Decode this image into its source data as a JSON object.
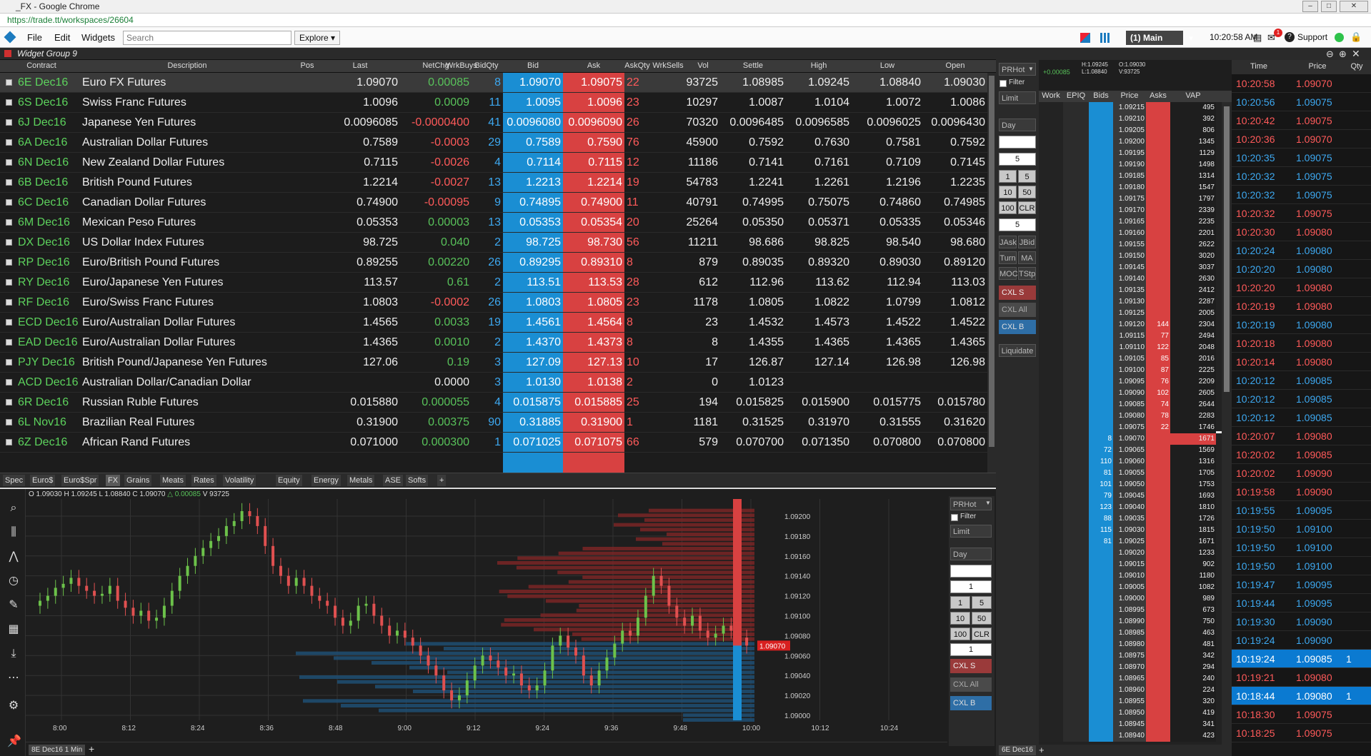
{
  "window": {
    "title": "_FX - Google Chrome",
    "url": "https://trade.tt/workspaces/26604"
  },
  "menu": {
    "file": "File",
    "edit": "Edit",
    "widgets": "Widgets",
    "search_placeholder": "Search",
    "explore": "Explore ▾",
    "workspace": "(1) Main",
    "time": "10:20:58 AM",
    "support": "Support",
    "alert_count": "1"
  },
  "widget_group": "Widget Group 9",
  "columns": [
    "Contract",
    "Description",
    "Pos",
    "Last",
    "NetChg",
    "WrkBuys",
    "BidQty",
    "Bid",
    "Ask",
    "AskQty",
    "WrkSells",
    "Vol",
    "Settle",
    "High",
    "Low",
    "Open"
  ],
  "rows": [
    {
      "contract": "6E Dec16",
      "desc": "Euro FX Futures",
      "last": "1.09070",
      "chg": "0.00085",
      "bidqty": "8",
      "bid": "1.09070",
      "ask": "1.09075",
      "askqty": "22",
      "vol": "93725",
      "settle": "1.08985",
      "high": "1.09245",
      "low": "1.08840",
      "open": "1.09030",
      "dir": "pos"
    },
    {
      "contract": "6S Dec16",
      "desc": "Swiss Franc Futures",
      "last": "1.0096",
      "chg": "0.0009",
      "bidqty": "11",
      "bid": "1.0095",
      "ask": "1.0096",
      "askqty": "23",
      "vol": "10297",
      "settle": "1.0087",
      "high": "1.0104",
      "low": "1.0072",
      "open": "1.0086",
      "dir": "pos"
    },
    {
      "contract": "6J Dec16",
      "desc": "Japanese Yen Futures",
      "last": "0.0096085",
      "chg": "-0.0000400",
      "bidqty": "41",
      "bid": "0.0096080",
      "ask": "0.0096090",
      "askqty": "26",
      "vol": "70320",
      "settle": "0.0096485",
      "high": "0.0096585",
      "low": "0.0096025",
      "open": "0.0096430",
      "dir": "neg"
    },
    {
      "contract": "6A Dec16",
      "desc": "Australian Dollar Futures",
      "last": "0.7589",
      "chg": "-0.0003",
      "bidqty": "29",
      "bid": "0.7589",
      "ask": "0.7590",
      "askqty": "76",
      "vol": "45900",
      "settle": "0.7592",
      "high": "0.7630",
      "low": "0.7581",
      "open": "0.7592",
      "dir": "neg"
    },
    {
      "contract": "6N Dec16",
      "desc": "New Zealand Dollar Futures",
      "last": "0.7115",
      "chg": "-0.0026",
      "bidqty": "4",
      "bid": "0.7114",
      "ask": "0.7115",
      "askqty": "12",
      "vol": "11186",
      "settle": "0.7141",
      "high": "0.7161",
      "low": "0.7109",
      "open": "0.7145",
      "dir": "neg"
    },
    {
      "contract": "6B Dec16",
      "desc": "British Pound Futures",
      "last": "1.2214",
      "chg": "-0.0027",
      "bidqty": "13",
      "bid": "1.2213",
      "ask": "1.2214",
      "askqty": "19",
      "vol": "54783",
      "settle": "1.2241",
      "high": "1.2261",
      "low": "1.2196",
      "open": "1.2235",
      "dir": "neg"
    },
    {
      "contract": "6C Dec16",
      "desc": "Canadian Dollar Futures",
      "last": "0.74900",
      "chg": "-0.00095",
      "bidqty": "9",
      "bid": "0.74895",
      "ask": "0.74900",
      "askqty": "11",
      "vol": "40791",
      "settle": "0.74995",
      "high": "0.75075",
      "low": "0.74860",
      "open": "0.74985",
      "dir": "neg"
    },
    {
      "contract": "6M Dec16",
      "desc": "Mexican Peso Futures",
      "last": "0.05353",
      "chg": "0.00003",
      "bidqty": "13",
      "bid": "0.05353",
      "ask": "0.05354",
      "askqty": "20",
      "vol": "25264",
      "settle": "0.05350",
      "high": "0.05371",
      "low": "0.05335",
      "open": "0.05346",
      "dir": "pos"
    },
    {
      "contract": "DX Dec16",
      "desc": "US Dollar Index Futures",
      "last": "98.725",
      "chg": "0.040",
      "bidqty": "2",
      "bid": "98.725",
      "ask": "98.730",
      "askqty": "56",
      "vol": "11211",
      "settle": "98.686",
      "high": "98.825",
      "low": "98.540",
      "open": "98.680",
      "dir": "pos"
    },
    {
      "contract": "RP Dec16",
      "desc": "Euro/British Pound Futures",
      "last": "0.89255",
      "chg": "0.00220",
      "bidqty": "26",
      "bid": "0.89295",
      "ask": "0.89310",
      "askqty": "8",
      "vol": "879",
      "settle": "0.89035",
      "high": "0.89320",
      "low": "0.89030",
      "open": "0.89120",
      "dir": "pos"
    },
    {
      "contract": "RY Dec16",
      "desc": "Euro/Japanese Yen Futures",
      "last": "113.57",
      "chg": "0.61",
      "bidqty": "2",
      "bid": "113.51",
      "ask": "113.53",
      "askqty": "28",
      "vol": "612",
      "settle": "112.96",
      "high": "113.62",
      "low": "112.94",
      "open": "113.03",
      "dir": "pos"
    },
    {
      "contract": "RF Dec16",
      "desc": "Euro/Swiss Franc Futures",
      "last": "1.0803",
      "chg": "-0.0002",
      "bidqty": "26",
      "bid": "1.0803",
      "ask": "1.0805",
      "askqty": "23",
      "vol": "1178",
      "settle": "1.0805",
      "high": "1.0822",
      "low": "1.0799",
      "open": "1.0812",
      "dir": "neg"
    },
    {
      "contract": "ECD Dec16",
      "desc": "Euro/Australian Dollar Futures",
      "last": "1.4565",
      "chg": "0.0033",
      "bidqty": "19",
      "bid": "1.4561",
      "ask": "1.4564",
      "askqty": "8",
      "vol": "23",
      "settle": "1.4532",
      "high": "1.4573",
      "low": "1.4522",
      "open": "1.4522",
      "dir": "pos"
    },
    {
      "contract": "EAD Dec16",
      "desc": "Euro/Australian Dollar Futures",
      "last": "1.4365",
      "chg": "0.0010",
      "bidqty": "2",
      "bid": "1.4370",
      "ask": "1.4373",
      "askqty": "8",
      "vol": "8",
      "settle": "1.4355",
      "high": "1.4365",
      "low": "1.4365",
      "open": "1.4365",
      "dir": "pos"
    },
    {
      "contract": "PJY Dec16",
      "desc": "British Pound/Japanese Yen Futures",
      "last": "127.06",
      "chg": "0.19",
      "bidqty": "3",
      "bid": "127.09",
      "ask": "127.13",
      "askqty": "10",
      "vol": "17",
      "settle": "126.87",
      "high": "127.14",
      "low": "126.98",
      "open": "126.98",
      "dir": "pos"
    },
    {
      "contract": "ACD Dec16",
      "desc": "Australian Dollar/Canadian Dollar",
      "last": "",
      "chg": "0.0000",
      "bidqty": "3",
      "bid": "1.0130",
      "ask": "1.0138",
      "askqty": "2",
      "vol": "0",
      "settle": "1.0123",
      "high": "",
      "low": "",
      "open": "",
      "dir": "zero"
    },
    {
      "contract": "6R Dec16",
      "desc": "Russian Ruble Futures",
      "last": "0.015880",
      "chg": "0.000055",
      "bidqty": "4",
      "bid": "0.015875",
      "ask": "0.015885",
      "askqty": "25",
      "vol": "194",
      "settle": "0.015825",
      "high": "0.015900",
      "low": "0.015775",
      "open": "0.015780",
      "dir": "pos"
    },
    {
      "contract": "6L Nov16",
      "desc": "Brazilian Real Futures",
      "last": "0.31900",
      "chg": "0.00375",
      "bidqty": "90",
      "bid": "0.31885",
      "ask": "0.31900",
      "askqty": "1",
      "vol": "1181",
      "settle": "0.31525",
      "high": "0.31970",
      "low": "0.31555",
      "open": "0.31620",
      "dir": "pos"
    },
    {
      "contract": "6Z Dec16",
      "desc": "African Rand Futures",
      "last": "0.071000",
      "chg": "0.000300",
      "bidqty": "1",
      "bid": "0.071025",
      "ask": "0.071075",
      "askqty": "66",
      "vol": "579",
      "settle": "0.070700",
      "high": "0.071350",
      "low": "0.070800",
      "open": "0.070800",
      "dir": "pos"
    }
  ],
  "tabs": [
    "Spec",
    "Euro$",
    "Euro$Spr",
    "FX",
    "Grains",
    "Meats",
    "Rates",
    "Volatility",
    "Equity",
    "Energy",
    "Metals",
    "ASE",
    "Softs",
    "+"
  ],
  "active_tab": "FX",
  "chart": {
    "ohlc": {
      "o": "O 1.09030",
      "h": "H 1.09245",
      "l": "L 1.08840",
      "c": "C 1.09070",
      "chg": "△ 0.00085",
      "v": "V 93725"
    },
    "contract_tab": "8E Dec16 1 Min",
    "price_marker": "1.09070"
  },
  "chart_data": {
    "type": "candlestick",
    "x_ticks": [
      "8:00",
      "8:12",
      "8:24",
      "8:36",
      "8:48",
      "9:00",
      "9:12",
      "9:24",
      "9:36",
      "9:48",
      "10:00",
      "10:12",
      "10:24"
    ],
    "y_ticks": [
      "1.09200",
      "1.09180",
      "1.09160",
      "1.09140",
      "1.09120",
      "1.09100",
      "1.09080",
      "1.09060",
      "1.09040",
      "1.09020",
      "1.09000"
    ],
    "ylim": [
      1.08995,
      1.0921
    ],
    "closes": [
      1.09115,
      1.0912,
      1.09128,
      1.09132,
      1.09138,
      1.0913,
      1.09125,
      1.0912,
      1.09122,
      1.0913,
      1.09115,
      1.09108,
      1.091,
      1.09105,
      1.09095,
      1.09098,
      1.0911,
      1.09125,
      1.0914,
      1.0915,
      1.0916,
      1.09168,
      1.09175,
      1.0918,
      1.0919,
      1.09195,
      1.09205,
      1.092,
      1.0919,
      1.0917,
      1.0915,
      1.0914,
      1.0913,
      1.09138,
      1.0913,
      1.0912,
      1.09115,
      1.0911,
      1.09098,
      1.0909,
      1.09095,
      1.0911,
      1.09112,
      1.091,
      1.0909,
      1.0908,
      1.09085,
      1.09078,
      1.0907,
      1.0906,
      1.0905,
      1.0904,
      1.09025,
      1.09015,
      1.0902,
      1.09035,
      1.0905,
      1.0906,
      1.09055,
      1.09048,
      1.0904,
      1.09042,
      1.0903,
      1.09025,
      1.0903,
      1.09045,
      1.0907,
      1.0908,
      1.09068,
      1.0906,
      1.0904,
      1.0903,
      1.09045,
      1.09058,
      1.09072,
      1.09085,
      1.0908,
      1.09098,
      1.0912,
      1.0914,
      1.0913,
      1.0911,
      1.09098,
      1.0909,
      1.091,
      1.09085,
      1.09078,
      1.09082,
      1.0909,
      1.09085,
      1.09078,
      1.0907
    ]
  },
  "order_panel": {
    "account": "PRHot",
    "filter": "Filter",
    "type": "Limit",
    "tif": "Day",
    "qty_top": "5",
    "qty": "5",
    "q1": "1",
    "q5": "5",
    "q10": "10",
    "q50": "50",
    "q100": "100",
    "clr": "CLR",
    "jask": "JAsk",
    "jbid": "JBid",
    "turn": "Turn",
    "ma": "MA",
    "moc": "MOC",
    "tstp": "TStp",
    "cxls": "CXL S",
    "cxla": "CXL All",
    "cxlb": "CXL B",
    "liquidate": "Liquidate",
    "chart_qty_top": "1",
    "chart_qty": "1"
  },
  "md_header": {
    "chg": "+0.00085",
    "hl": "H:1.09245\nL:1.08840",
    "ov": "O:1.09030\nV:93725",
    "cols": [
      "Work",
      "EPIQ",
      "Bids",
      "Price",
      "Asks",
      "VAP"
    ],
    "contract": "6E Dec16"
  },
  "ladder": [
    [
      "",
      "",
      "1.09215",
      "",
      "495"
    ],
    [
      "",
      "",
      "1.09210",
      "",
      "392"
    ],
    [
      "",
      "",
      "1.09205",
      "",
      "806"
    ],
    [
      "",
      "",
      "1.09200",
      "",
      "1345"
    ],
    [
      "",
      "",
      "1.09195",
      "",
      "1129"
    ],
    [
      "",
      "",
      "1.09190",
      "",
      "1498"
    ],
    [
      "",
      "",
      "1.09185",
      "",
      "1314"
    ],
    [
      "",
      "",
      "1.09180",
      "",
      "1547"
    ],
    [
      "",
      "",
      "1.09175",
      "",
      "1797"
    ],
    [
      "",
      "",
      "1.09170",
      "",
      "2339"
    ],
    [
      "",
      "",
      "1.09165",
      "",
      "2235"
    ],
    [
      "",
      "",
      "1.09160",
      "",
      "2201"
    ],
    [
      "",
      "",
      "1.09155",
      "",
      "2622"
    ],
    [
      "",
      "",
      "1.09150",
      "",
      "3020"
    ],
    [
      "",
      "",
      "1.09145",
      "",
      "3037"
    ],
    [
      "",
      "",
      "1.09140",
      "",
      "2630"
    ],
    [
      "",
      "",
      "1.09135",
      "",
      "2412"
    ],
    [
      "",
      "",
      "1.09130",
      "",
      "2287"
    ],
    [
      "",
      "",
      "1.09125",
      "",
      "2005"
    ],
    [
      "",
      "",
      "1.09120",
      "144",
      "2304"
    ],
    [
      "",
      "",
      "1.09115",
      "77",
      "2494"
    ],
    [
      "",
      "",
      "1.09110",
      "122",
      "2048"
    ],
    [
      "",
      "",
      "1.09105",
      "85",
      "2016"
    ],
    [
      "",
      "",
      "1.09100",
      "87",
      "2225"
    ],
    [
      "",
      "",
      "1.09095",
      "76",
      "2209"
    ],
    [
      "",
      "",
      "1.09090",
      "102",
      "2605"
    ],
    [
      "",
      "",
      "1.09085",
      "74",
      "2644"
    ],
    [
      "",
      "",
      "1.09080",
      "78",
      "2283"
    ],
    [
      "",
      "",
      "1.09075",
      "22",
      "1746"
    ],
    [
      "",
      "8",
      "1.09070",
      "",
      "1671"
    ],
    [
      "",
      "72",
      "1.09065",
      "",
      "1569"
    ],
    [
      "",
      "110",
      "1.09060",
      "",
      "1316"
    ],
    [
      "",
      "81",
      "1.09055",
      "",
      "1705"
    ],
    [
      "",
      "101",
      "1.09050",
      "",
      "1753"
    ],
    [
      "",
      "79",
      "1.09045",
      "",
      "1693"
    ],
    [
      "",
      "123",
      "1.09040",
      "",
      "1810"
    ],
    [
      "",
      "88",
      "1.09035",
      "",
      "1726"
    ],
    [
      "",
      "115",
      "1.09030",
      "",
      "1815"
    ],
    [
      "",
      "81",
      "1.09025",
      "",
      "1671"
    ],
    [
      "",
      "",
      "1.09020",
      "",
      "1233"
    ],
    [
      "",
      "",
      "1.09015",
      "",
      "902"
    ],
    [
      "",
      "",
      "1.09010",
      "",
      "1180"
    ],
    [
      "",
      "",
      "1.09005",
      "",
      "1082"
    ],
    [
      "",
      "",
      "1.09000",
      "",
      "989"
    ],
    [
      "",
      "",
      "1.08995",
      "",
      "673"
    ],
    [
      "",
      "",
      "1.08990",
      "",
      "750"
    ],
    [
      "",
      "",
      "1.08985",
      "",
      "463"
    ],
    [
      "",
      "",
      "1.08980",
      "",
      "481"
    ],
    [
      "",
      "",
      "1.08975",
      "",
      "342"
    ],
    [
      "",
      "",
      "1.08970",
      "",
      "294"
    ],
    [
      "",
      "",
      "1.08965",
      "",
      "240"
    ],
    [
      "",
      "",
      "1.08960",
      "",
      "224"
    ],
    [
      "",
      "",
      "1.08955",
      "",
      "320"
    ],
    [
      "",
      "",
      "1.08950",
      "",
      "419"
    ],
    [
      "",
      "",
      "1.08945",
      "",
      "341"
    ],
    [
      "",
      "",
      "1.08940",
      "",
      "423"
    ]
  ],
  "time_sales_header": [
    "Time",
    "Price",
    "Qty"
  ],
  "time_sales": [
    [
      "10:20:58",
      "1.09070",
      ""
    ],
    [
      "10:20:56",
      "1.09075",
      ""
    ],
    [
      "10:20:42",
      "1.09075",
      ""
    ],
    [
      "10:20:36",
      "1.09070",
      ""
    ],
    [
      "10:20:35",
      "1.09075",
      ""
    ],
    [
      "10:20:32",
      "1.09075",
      ""
    ],
    [
      "10:20:32",
      "1.09075",
      ""
    ],
    [
      "10:20:32",
      "1.09075",
      ""
    ],
    [
      "10:20:30",
      "1.09080",
      ""
    ],
    [
      "10:20:24",
      "1.09080",
      ""
    ],
    [
      "10:20:20",
      "1.09080",
      ""
    ],
    [
      "10:20:20",
      "1.09080",
      ""
    ],
    [
      "10:20:19",
      "1.09080",
      ""
    ],
    [
      "10:20:19",
      "1.09080",
      ""
    ],
    [
      "10:20:18",
      "1.09080",
      ""
    ],
    [
      "10:20:14",
      "1.09080",
      ""
    ],
    [
      "10:20:12",
      "1.09085",
      ""
    ],
    [
      "10:20:12",
      "1.09085",
      ""
    ],
    [
      "10:20:12",
      "1.09085",
      ""
    ],
    [
      "10:20:07",
      "1.09080",
      ""
    ],
    [
      "10:20:02",
      "1.09085",
      ""
    ],
    [
      "10:20:02",
      "1.09090",
      ""
    ],
    [
      "10:19:58",
      "1.09090",
      ""
    ],
    [
      "10:19:55",
      "1.09095",
      ""
    ],
    [
      "10:19:50",
      "1.09100",
      ""
    ],
    [
      "10:19:50",
      "1.09100",
      ""
    ],
    [
      "10:19:50",
      "1.09100",
      ""
    ],
    [
      "10:19:47",
      "1.09095",
      ""
    ],
    [
      "10:19:44",
      "1.09095",
      ""
    ],
    [
      "10:19:30",
      "1.09090",
      ""
    ],
    [
      "10:19:24",
      "1.09090",
      ""
    ],
    [
      "10:19:24",
      "1.09085",
      "1"
    ],
    [
      "10:19:21",
      "1.09080",
      ""
    ],
    [
      "10:18:44",
      "1.09080",
      "1"
    ],
    [
      "10:18:30",
      "1.09075",
      ""
    ],
    [
      "10:18:25",
      "1.09075",
      ""
    ]
  ],
  "colors": {
    "bid": "#1a8ed3",
    "ask": "#d84141",
    "up": "#58c25a",
    "down": "#ff5a5a",
    "contract": "#5dd35d"
  }
}
